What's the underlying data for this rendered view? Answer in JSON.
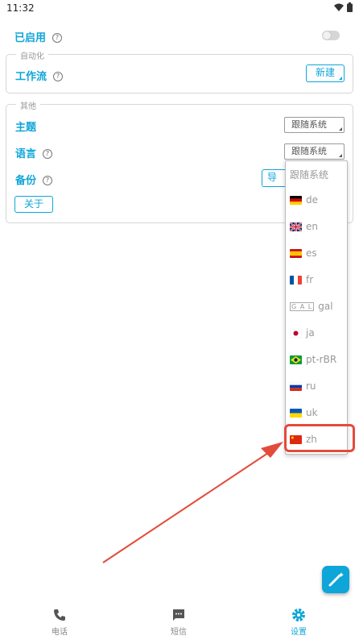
{
  "status": {
    "time": "11:32",
    "wifi_icon": "wifi-icon",
    "battery_icon": "battery-icon"
  },
  "enabled": {
    "label": "已启用",
    "help_icon": "help-icon",
    "toggle_state": "off"
  },
  "automation": {
    "legend": "自动化",
    "workflow_label": "工作流",
    "new_button": "新建"
  },
  "other": {
    "legend": "其他",
    "theme_label": "主题",
    "theme_value": "跟随系统",
    "language_label": "语言",
    "language_value": "跟随系统",
    "backup_label": "备份",
    "backup_button": "导",
    "about_button": "关于"
  },
  "language_menu": {
    "items": [
      {
        "label": "跟随系统",
        "flag": ""
      },
      {
        "label": "de",
        "flag": "german-flag"
      },
      {
        "label": "en",
        "flag": "uk-flag"
      },
      {
        "label": "es",
        "flag": "spain-flag"
      },
      {
        "label": "fr",
        "flag": "france-flag"
      },
      {
        "label": "gal",
        "flag": "gal-tag"
      },
      {
        "label": "ja",
        "flag": "japan-flag"
      },
      {
        "label": "pt-rBR",
        "flag": "brazil-flag"
      },
      {
        "label": "ru",
        "flag": "russia-flag"
      },
      {
        "label": "uk",
        "flag": "ukraine-flag"
      },
      {
        "label": "zh",
        "flag": "china-flag"
      }
    ],
    "highlighted": "zh"
  },
  "nav": {
    "phone": "电话",
    "sms": "短信",
    "settings": "设置",
    "active": "settings"
  },
  "colors": {
    "accent": "#0ea5d9",
    "annotation": "#e34b3b"
  }
}
